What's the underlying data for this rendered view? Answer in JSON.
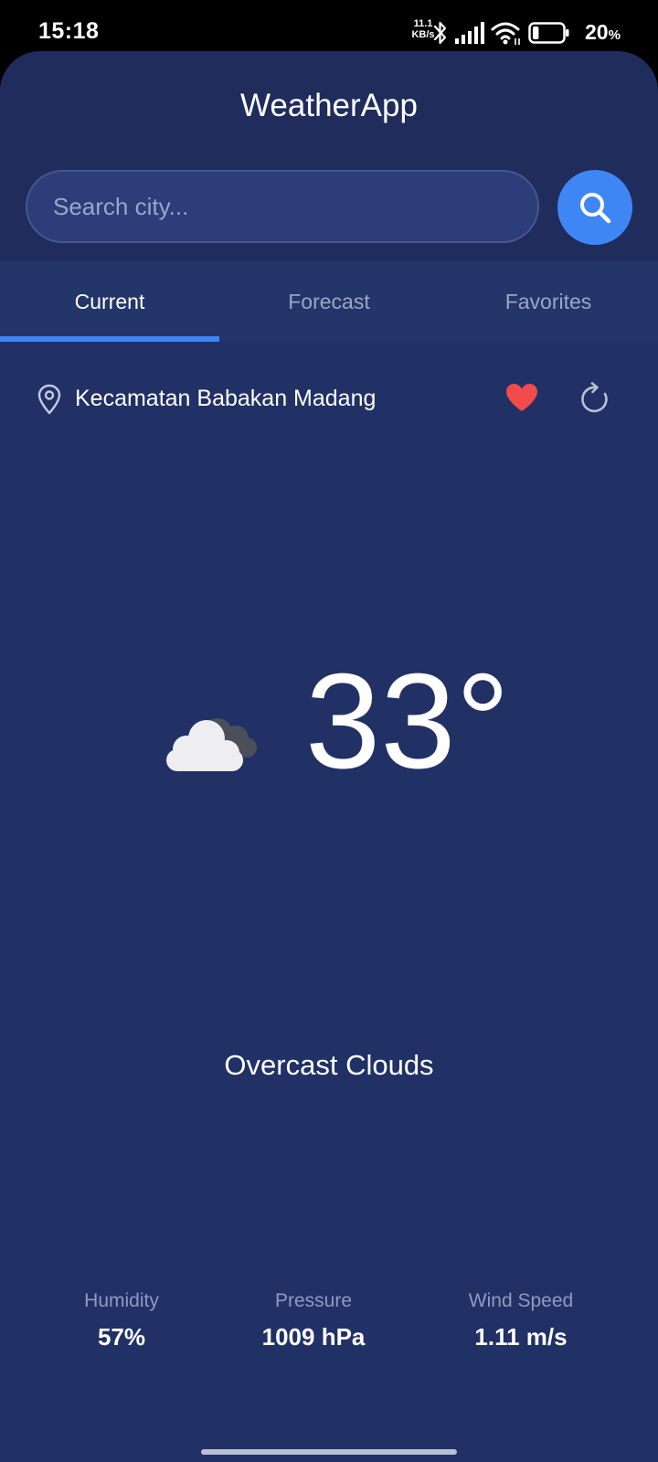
{
  "status_bar": {
    "time": "15:18",
    "net_speed_value": "11.1",
    "net_speed_unit": "KB/s",
    "battery_percent": "20",
    "battery_sign": "%",
    "battery_level": 0.2
  },
  "app": {
    "title": "WeatherApp",
    "search": {
      "placeholder": "Search city..."
    }
  },
  "tabs": [
    {
      "label": "Current",
      "active": true
    },
    {
      "label": "Forecast",
      "active": false
    },
    {
      "label": "Favorites",
      "active": false
    }
  ],
  "location": {
    "name": "Kecamatan Babakan Madang",
    "favorited": true
  },
  "current": {
    "temperature": "33°",
    "condition": "Overcast Clouds",
    "icon": "overcast-clouds-icon"
  },
  "stats": [
    {
      "label": "Humidity",
      "value": "57%"
    },
    {
      "label": "Pressure",
      "value": "1009 hPa"
    },
    {
      "label": "Wind Speed",
      "value": "1.11 m/s"
    }
  ],
  "colors": {
    "accent": "#3f86f5",
    "background": "#213166",
    "header": "#1f2c5c",
    "heart": "#f14b4b"
  }
}
